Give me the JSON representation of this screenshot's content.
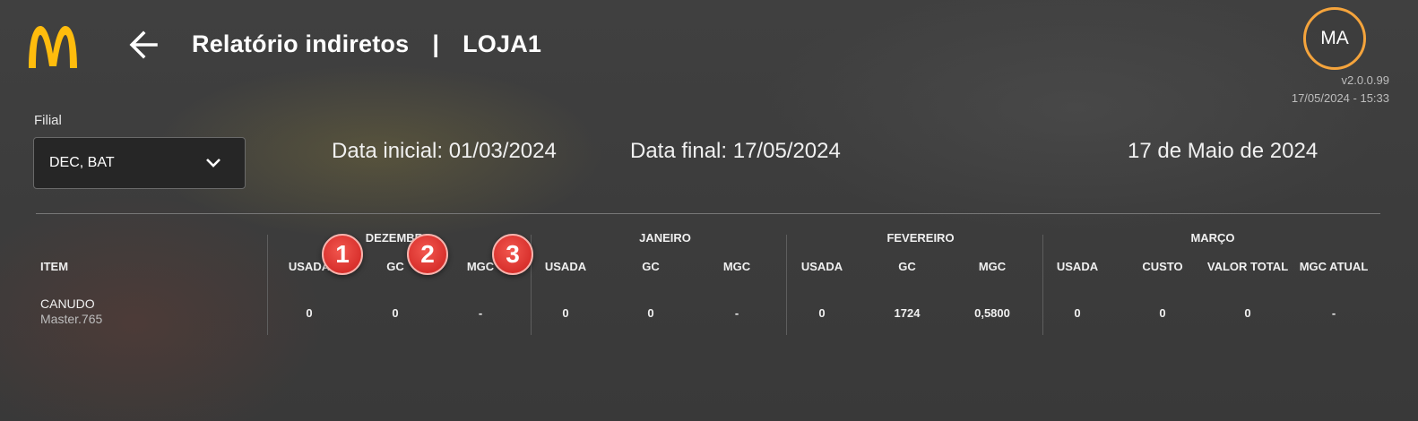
{
  "header": {
    "title": "Relatório indiretos",
    "separator": "|",
    "store": "LOJA1",
    "avatar_initials": "MA",
    "version": "v2.0.0.99",
    "datetime": "17/05/2024 - 15:33"
  },
  "filter": {
    "label": "Filial",
    "value": "DEC, BAT"
  },
  "dates": {
    "initial": "Data inicial: 01/03/2024",
    "final": "Data final: 17/05/2024",
    "today": "17 de Maio de 2024"
  },
  "table": {
    "item_header": "ITEM",
    "months": [
      {
        "name": "DEZEMBRO",
        "columns": [
          "USADA",
          "GC",
          "MGC"
        ],
        "values": [
          "0",
          "0",
          "-"
        ]
      },
      {
        "name": "JANEIRO",
        "columns": [
          "USADA",
          "GC",
          "MGC"
        ],
        "values": [
          "0",
          "0",
          "-"
        ]
      },
      {
        "name": "FEVEREIRO",
        "columns": [
          "USADA",
          "GC",
          "MGC"
        ],
        "values": [
          "0",
          "1724",
          "0,5800"
        ]
      },
      {
        "name": "MARÇO",
        "columns": [
          "USADA",
          "CUSTO",
          "VALOR TOTAL",
          "MGC ATUAL"
        ],
        "values": [
          "0",
          "0",
          "0",
          "-"
        ]
      }
    ],
    "row": {
      "name": "CANUDO",
      "code": "Master.765"
    }
  },
  "badges": [
    "1",
    "2",
    "3"
  ],
  "colors": {
    "logo": "#ffbc0d",
    "avatar_ring": "#f5a43c",
    "badge": "#e03a34"
  },
  "icons": {
    "logo": "mcdonalds-arches-icon",
    "back": "arrow-left-icon",
    "dropdown": "chevron-down-icon"
  }
}
